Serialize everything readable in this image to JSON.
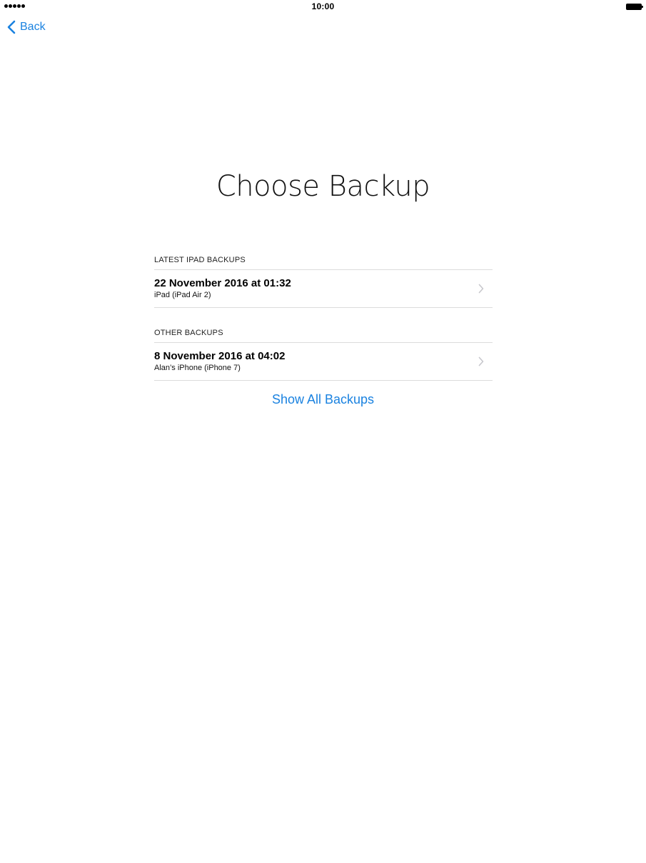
{
  "status_bar": {
    "time": "10:00",
    "signal_icon": "signal-dots-icon",
    "battery_icon": "battery-full-icon"
  },
  "nav": {
    "back_label": "Back",
    "back_icon": "chevron-left-icon"
  },
  "title": "Choose Backup",
  "sections": [
    {
      "header": "LATEST IPAD BACKUPS",
      "items": [
        {
          "title": "22 November 2016 at 01:32",
          "subtitle": "iPad (iPad Air 2)"
        }
      ]
    },
    {
      "header": "OTHER BACKUPS",
      "items": [
        {
          "title": "8 November 2016 at 04:02",
          "subtitle": "Alan’s iPhone (iPhone 7)"
        }
      ]
    }
  ],
  "show_all_label": "Show All Backups",
  "colors": {
    "accent": "#1a82e0",
    "separator": "#dcdcdc",
    "chevron": "#c7c7cc"
  }
}
